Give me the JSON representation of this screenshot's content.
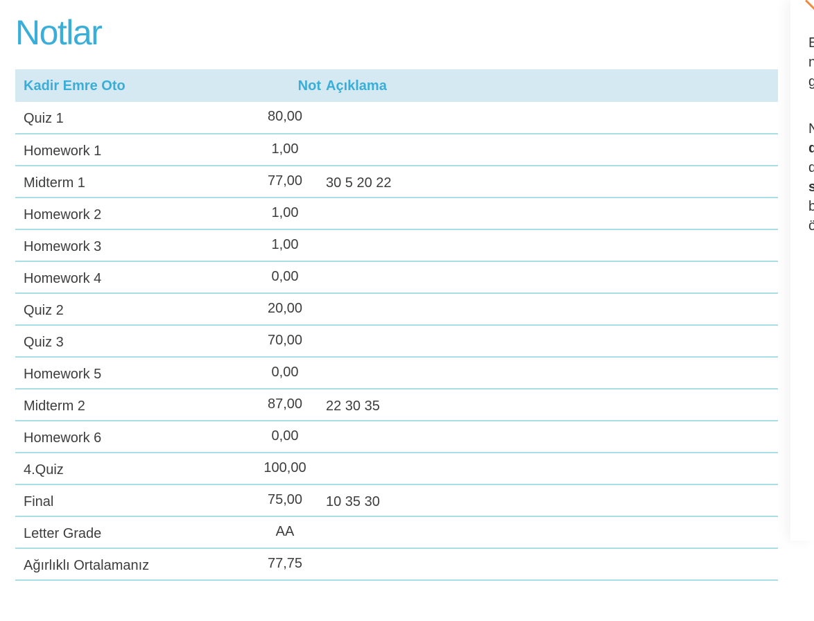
{
  "page": {
    "title": "Notlar"
  },
  "table": {
    "headers": {
      "name": "Kadir Emre Oto",
      "score": "Not",
      "description": "Açıklama"
    },
    "rows": [
      {
        "name": "Quiz 1",
        "score": "80,00",
        "description": ""
      },
      {
        "name": "Homework 1",
        "score": "1,00",
        "description": ""
      },
      {
        "name": "Midterm 1",
        "score": "77,00",
        "description": "30 5 20 22"
      },
      {
        "name": "Homework 2",
        "score": "1,00",
        "description": ""
      },
      {
        "name": "Homework 3",
        "score": "1,00",
        "description": ""
      },
      {
        "name": "Homework 4",
        "score": "0,00",
        "description": ""
      },
      {
        "name": "Quiz 2",
        "score": "20,00",
        "description": ""
      },
      {
        "name": "Quiz 3",
        "score": "70,00",
        "description": ""
      },
      {
        "name": "Homework 5",
        "score": "0,00",
        "description": ""
      },
      {
        "name": "Midterm 2",
        "score": "87,00",
        "description": "22 30 35"
      },
      {
        "name": "Homework 6",
        "score": "0,00",
        "description": ""
      },
      {
        "name": "4.Quiz",
        "score": "100,00",
        "description": ""
      },
      {
        "name": "Final",
        "score": "75,00",
        "description": "10 35 30"
      },
      {
        "name": "Letter Grade",
        "score": "AA",
        "description": ""
      },
      {
        "name": "Ağırlıklı Ortalamanız",
        "score": "77,75",
        "description": ""
      }
    ]
  },
  "side_panel": {
    "lines": [
      "E",
      "n",
      "g",
      "N",
      "d",
      "d",
      "s",
      "b",
      "ö"
    ]
  },
  "colors": {
    "accent_blue": "#3aaed8",
    "header_bg": "#d4e9f1",
    "row_divider": "#a8dde4",
    "side_accent_orange": "#f08a3c",
    "text": "#3d3d3d"
  }
}
